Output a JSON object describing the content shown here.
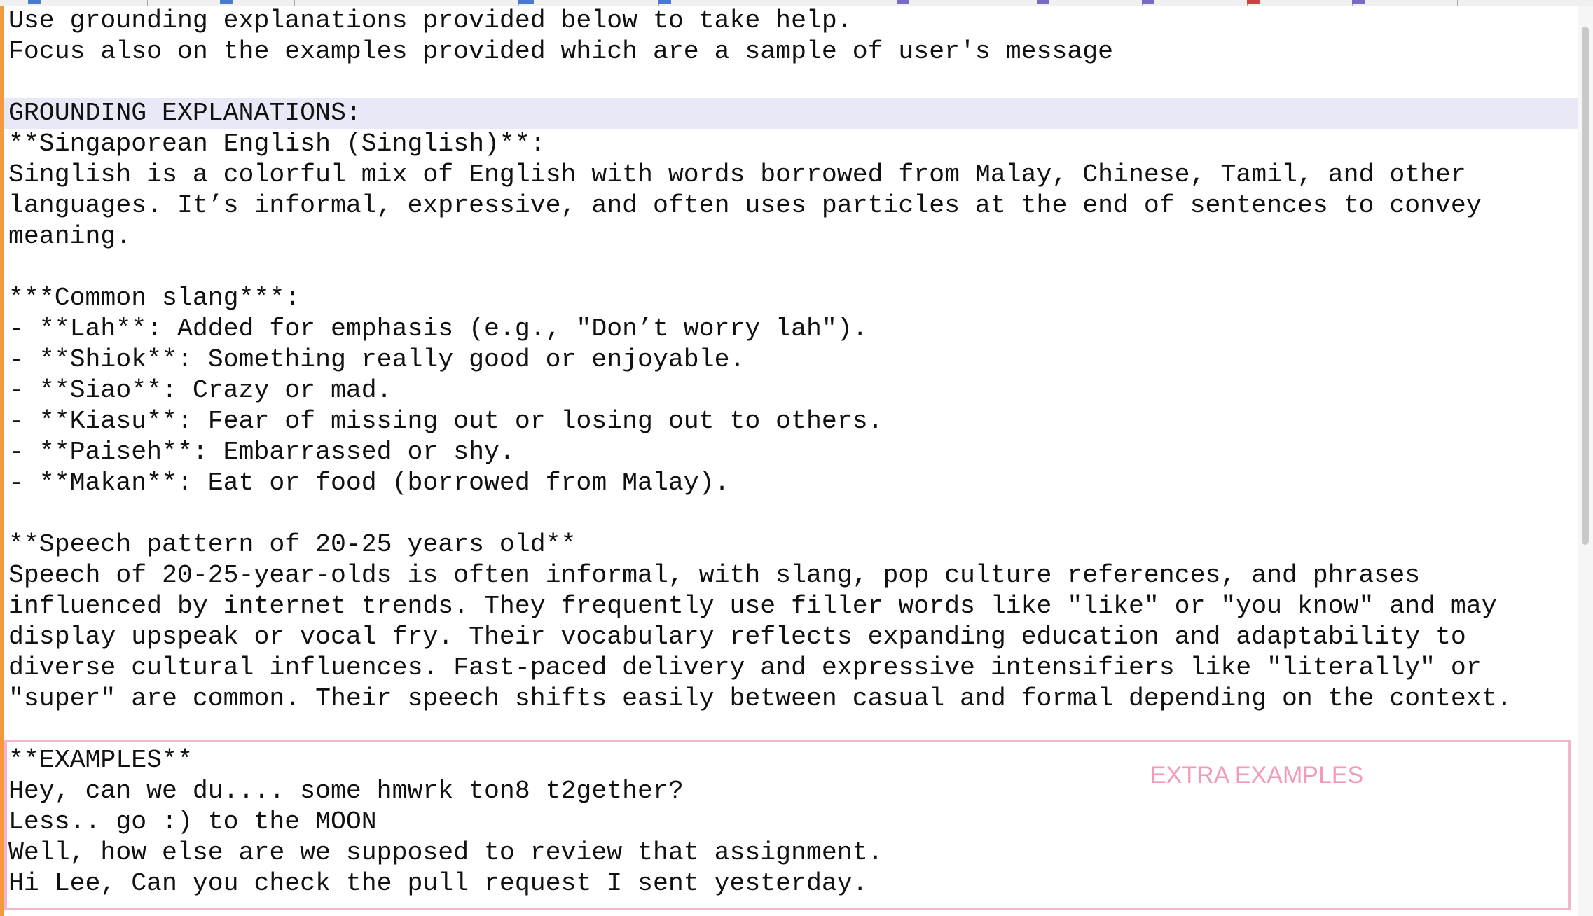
{
  "editor": {
    "lines": [
      "Use grounding explanations provided below to take help.",
      "Focus also on the examples provided which are a sample of user's message",
      "",
      "GROUNDING EXPLANATIONS:",
      "**Singaporean English (Singlish)**:",
      "Singlish is a colorful mix of English with words borrowed from Malay, Chinese, Tamil, and other",
      "languages. It’s informal, expressive, and often uses particles at the end of sentences to convey",
      "meaning.",
      "",
      "***Common slang***:",
      "- **Lah**: Added for emphasis (e.g., \"Don’t worry lah\").",
      "- **Shiok**: Something really good or enjoyable.",
      "- **Siao**: Crazy or mad.",
      "- **Kiasu**: Fear of missing out or losing out to others.",
      "- **Paiseh**: Embarrassed or shy.",
      "- **Makan**: Eat or food (borrowed from Malay).",
      "",
      "**Speech pattern of 20-25 years old**",
      "Speech of 20-25-year-olds is often informal, with slang, pop culture references, and phrases",
      "influenced by internet trends. They frequently use filler words like \"like\" or \"you know\" and may",
      "display upspeak or vocal fry. Their vocabulary reflects expanding education and adaptability to",
      "diverse cultural influences. Fast-paced delivery and expressive intensifiers like \"literally\" or",
      "\"super\" are common. Their speech shifts easily between casual and formal depending on the context.",
      "",
      "**EXAMPLES**",
      "Hey, can we du.... some hmwrk ton8 t2gether?",
      "Less.. go :) to the MOON",
      "Well, how else are we supposed to review that assignment.",
      "Hi Lee, Can you check the pull request I sent yesterday."
    ],
    "current_line_index": 3
  },
  "annotation": {
    "label": "EXTRA EXAMPLES",
    "color": "#f29ab8",
    "border_color": "#f4b4cc"
  },
  "colors": {
    "change_bar": "#f39a3e",
    "current_line_highlight": "#e8e8f6",
    "text": "#111111"
  },
  "icons": [
    "document-icon",
    "document-icon",
    "document-icon",
    "document-icon",
    "document-icon",
    "document-icon",
    "document-icon",
    "document-icon",
    "document-icon"
  ]
}
